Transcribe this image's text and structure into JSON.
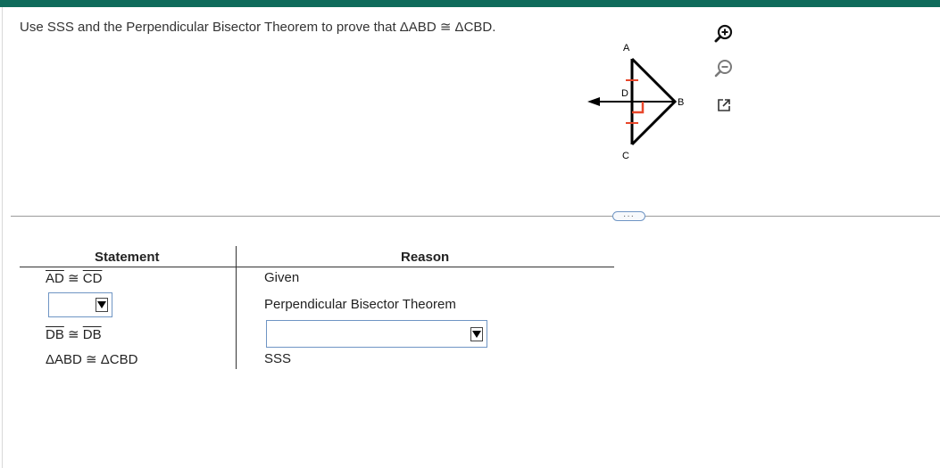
{
  "prompt": "Use SSS and the Perpendicular Bisector Theorem to prove that ΔABD ≅ ΔCBD.",
  "figure": {
    "labels": {
      "a": "A",
      "b": "B",
      "c": "C",
      "d": "D"
    },
    "colors": {
      "lines": "#000000",
      "marks": "#e8462a"
    }
  },
  "tools": {
    "zoom_in": "zoom-in-icon",
    "zoom_out": "zoom-out-icon",
    "popout": "popout-icon"
  },
  "more_button": "···",
  "proof": {
    "statement_header": "Statement",
    "reason_header": "Reason",
    "rows": [
      {
        "statement_seg1": "AD",
        "statement_rel": " ≅ ",
        "statement_seg2": "CD",
        "reason": "Given"
      },
      {
        "statement_dropdown_value": "",
        "reason": "Perpendicular Bisector Theorem"
      },
      {
        "statement_seg1": "DB",
        "statement_rel": " ≅ ",
        "statement_seg2": "DB",
        "reason_dropdown_value": ""
      },
      {
        "statement": "ΔABD ≅ ΔCBD",
        "reason": "SSS"
      }
    ]
  },
  "theme": {
    "topbar": "#0f6b5b",
    "dropdown_border": "#6f95c4"
  }
}
